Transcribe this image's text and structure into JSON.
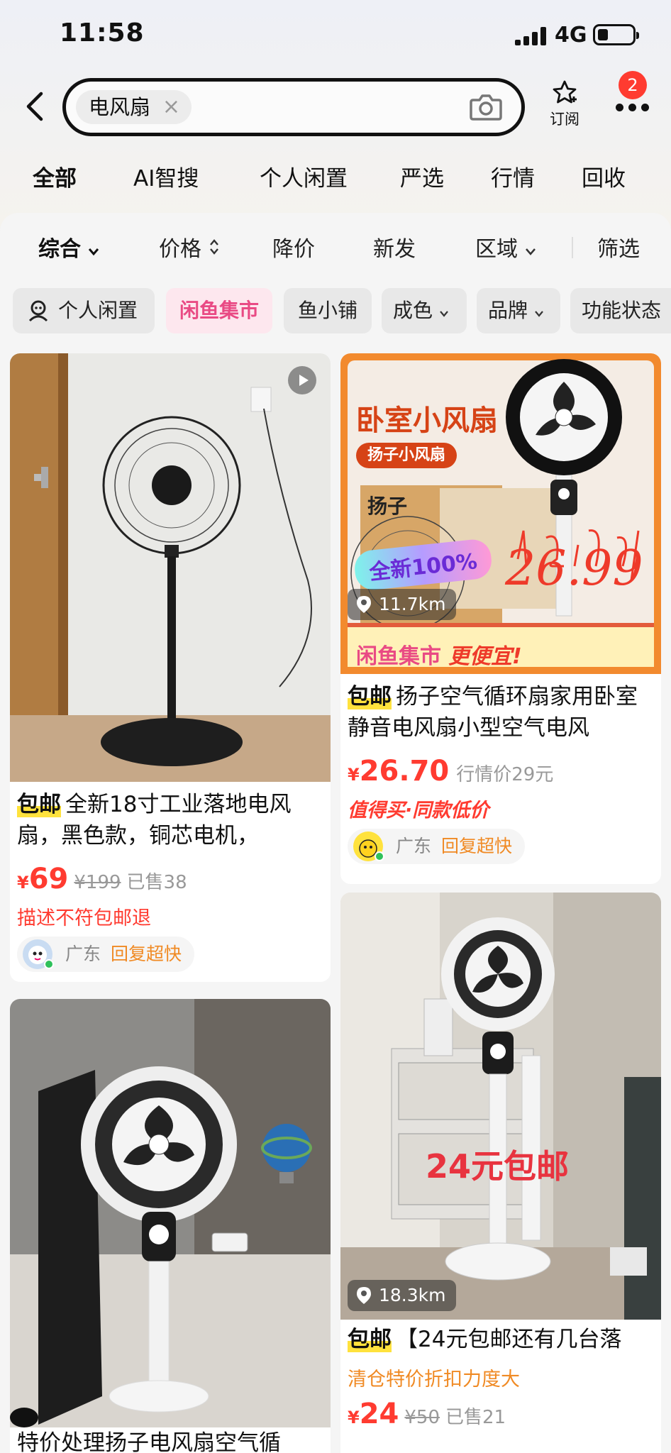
{
  "status_bar": {
    "time": "11:58",
    "network": "4G"
  },
  "search": {
    "query": "电风扇",
    "clear_symbol": "×"
  },
  "header": {
    "subscribe_label": "订阅",
    "notification_count": "2"
  },
  "category_tabs": [
    "全部",
    "AI智搜",
    "个人闲置",
    "严选",
    "行情",
    "回收"
  ],
  "sort_bar": {
    "comprehensive": "综合",
    "price": "价格",
    "price_drop": "降价",
    "newest": "新发",
    "region": "区域",
    "filter": "筛选"
  },
  "filter_chips": [
    "个人闲置",
    "闲鱼集市",
    "鱼小铺",
    "成色",
    "品牌",
    "功能状态"
  ],
  "products": [
    {
      "tag": "包邮",
      "title": "全新18寸工业落地电风扇，黑色款，铜芯电机，",
      "price_symbol": "¥",
      "price": "69",
      "original_price": "¥199",
      "sold": "已售38",
      "note": "描述不符包邮退",
      "seller_region": "广东",
      "seller_badge": "回复超快"
    },
    {
      "distance": "11.7km",
      "banner_text": "卧室小风扇",
      "banner_sub": "扬子小风扇",
      "banner_brand": "扬子",
      "banner_new": "全新100%",
      "banner_handwritten": "26.99",
      "market_name": "闲鱼集市",
      "market_slogan": "更便宜!",
      "tag": "包邮",
      "title": "扬子空气循环扇家用卧室静音电风扇小型空气电风",
      "price_symbol": "¥",
      "price": "26.70",
      "reference_price": "行情价29元",
      "note": "值得买·同款低价",
      "seller_region": "广东",
      "seller_badge": "回复超快"
    },
    {
      "title": "特价处理扬子电风扇空气循"
    },
    {
      "distance": "18.3km",
      "overlay_text": "24元包邮",
      "tag": "包邮",
      "title": "【24元包邮还有几台落",
      "note": "清仓特价折扣力度大",
      "price_symbol": "¥",
      "price": "24",
      "original_price": "¥50",
      "sold": "已售21"
    }
  ],
  "colors": {
    "accent_yellow": "#ffe23d",
    "price_red": "#ff3b30",
    "market_pink": "#e94a84",
    "reply_orange": "#f08a24"
  }
}
